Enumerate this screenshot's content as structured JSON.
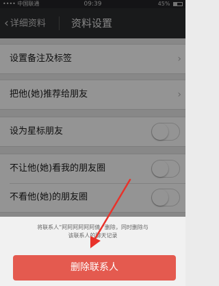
{
  "status_bar": {
    "carrier": "•••• 中国联通",
    "time": "09:39",
    "battery": "45%",
    "battery_level": 0.45
  },
  "nav": {
    "back_label": "详细资料",
    "title": "资料设置"
  },
  "settings": {
    "group1": [
      {
        "label": "设置备注及标签"
      }
    ],
    "group2": [
      {
        "label": "把他(她)推荐给朋友"
      }
    ],
    "group3": [
      {
        "label": "设为星标朋友",
        "on": false
      }
    ],
    "group4": [
      {
        "label": "不让他(她)看我的朋友圈",
        "on": false
      },
      {
        "label": "不看他(她)的朋友圈",
        "on": false
      }
    ]
  },
  "dialog": {
    "message_line1": "将联系人“阿阿阿阿阿阿倩 ”删除，同时删除与",
    "message_line2": "该联系人的聊天记录",
    "delete_label": "删除联系人"
  },
  "colors": {
    "delete_button": "#e45a4f",
    "annotation_arrow": "#e8322a"
  }
}
